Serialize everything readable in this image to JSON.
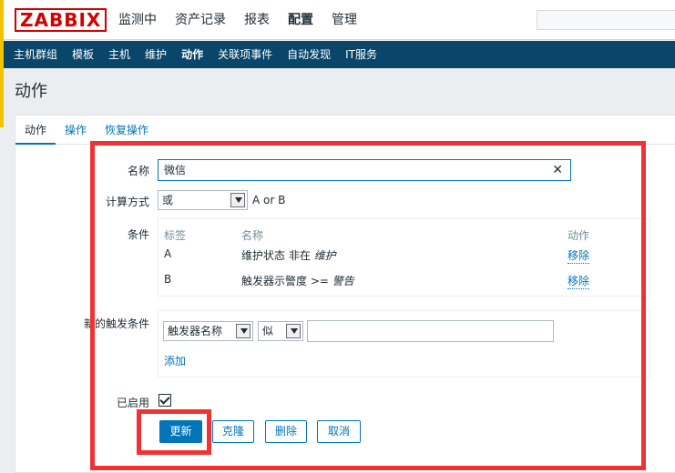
{
  "header": {
    "logo": "ZABBIX",
    "menu": [
      "监测中",
      "资产记录",
      "报表",
      "配置",
      "管理"
    ],
    "active_menu": "配置"
  },
  "submenu": {
    "items": [
      "主机群组",
      "模板",
      "主机",
      "维护",
      "动作",
      "关联项事件",
      "自动发现",
      "IT服务"
    ],
    "active": "动作"
  },
  "page": {
    "title": "动作"
  },
  "tabs": [
    "动作",
    "操作",
    "恢复操作"
  ],
  "form": {
    "name_label": "名称",
    "name_value": "微信",
    "calc_label": "计算方式",
    "calc_value": "或",
    "calc_formula": "A or B",
    "conditions_label": "条件",
    "conditions_headers": {
      "tag": "标签",
      "name": "名称",
      "action": "动作"
    },
    "conditions": [
      {
        "tag": "A",
        "name_prefix": "维护状态 非在",
        "name_value": "维护",
        "action": "移除"
      },
      {
        "tag": "B",
        "name_prefix": "触发器示警度 >=",
        "name_value": "警告",
        "action": "移除"
      }
    ],
    "new_condition_label": "新的触发条件",
    "new_condition_type": "触发器名称",
    "new_condition_operator": "似",
    "new_condition_value": "",
    "add_link": "添加",
    "enabled_label": "已启用",
    "enabled": true
  },
  "buttons": {
    "update": "更新",
    "clone": "克隆",
    "delete": "删除",
    "cancel": "取消"
  },
  "colors": {
    "brand": "#d40000",
    "nav": "#0a466a",
    "accent": "#0275b8",
    "annotation": "#ef3234"
  }
}
